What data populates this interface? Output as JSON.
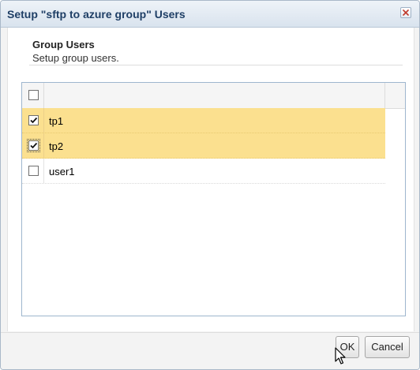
{
  "dialog": {
    "title": "Setup \"sftp to azure group\" Users",
    "close_icon": "close-x-icon"
  },
  "section": {
    "title": "Group Users",
    "subtitle": "Setup group users."
  },
  "grid": {
    "header_checked": false,
    "rows": [
      {
        "name": "tp1",
        "checked": true,
        "selected": true
      },
      {
        "name": "tp2",
        "checked": true,
        "selected": true
      },
      {
        "name": "user1",
        "checked": false,
        "selected": false
      }
    ],
    "selected_color": "#fbe08f"
  },
  "buttons": {
    "ok_label": "OK",
    "cancel_label": "Cancel"
  },
  "colors": {
    "title_text": "#1f3f66",
    "grid_border": "#9eb6ce"
  }
}
